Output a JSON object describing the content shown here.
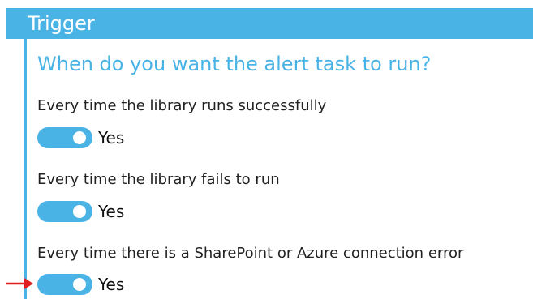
{
  "section": {
    "title": "Trigger",
    "question": "When do you want the alert task to run?"
  },
  "options": [
    {
      "label": "Every time the library runs successfully",
      "toggle_text": "Yes",
      "enabled": true
    },
    {
      "label": "Every time the library fails to run",
      "toggle_text": "Yes",
      "enabled": true
    },
    {
      "label": "Every time there is a SharePoint or Azure connection error",
      "toggle_text": "Yes",
      "enabled": true
    }
  ],
  "colors": {
    "accent": "#4ab3e5",
    "arrow": "#e02020"
  },
  "icons": {
    "pointer": "red-arrow-icon"
  }
}
